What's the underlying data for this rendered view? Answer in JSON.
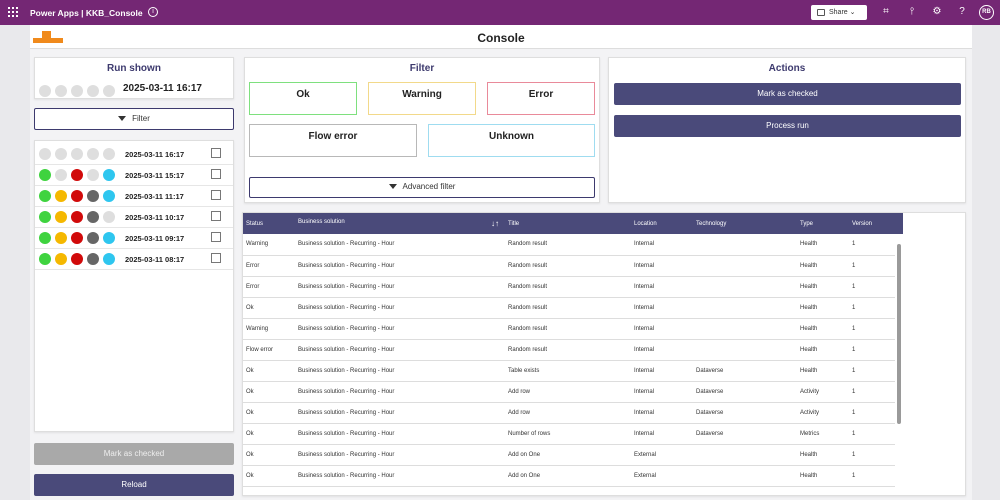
{
  "topbar": {
    "title": "Power Apps  |  KKB_Console",
    "share_label": "Share",
    "avatar_initials": "RB"
  },
  "header": {
    "title": "Console"
  },
  "run_shown": {
    "title": "Run shown",
    "date": "2025-03-11 16:17",
    "dots": [
      "#dedede",
      "#dedede",
      "#dedede",
      "#dedede",
      "#dedede"
    ]
  },
  "filter_button": "Filter",
  "runs": [
    {
      "date": "2025-03-11 16:17",
      "dots": [
        "#dedede",
        "#dedede",
        "#dedede",
        "#dedede",
        "#dedede"
      ]
    },
    {
      "date": "2025-03-11 15:17",
      "dots": [
        "#3fd33f",
        "#dedede",
        "#d10a0a",
        "#dedede",
        "#2ec6ef"
      ]
    },
    {
      "date": "2025-03-11 11:17",
      "dots": [
        "#3fd33f",
        "#f5b800",
        "#d10a0a",
        "#666666",
        "#2ec6ef"
      ]
    },
    {
      "date": "2025-03-11 10:17",
      "dots": [
        "#3fd33f",
        "#f5b800",
        "#d10a0a",
        "#666666",
        "#dedede"
      ]
    },
    {
      "date": "2025-03-11 09:17",
      "dots": [
        "#3fd33f",
        "#f5b800",
        "#d10a0a",
        "#666666",
        "#2ec6ef"
      ]
    },
    {
      "date": "2025-03-11 08:17",
      "dots": [
        "#3fd33f",
        "#f5b800",
        "#d10a0a",
        "#666666",
        "#2ec6ef"
      ]
    }
  ],
  "left_actions": {
    "mark_checked": "Mark as checked",
    "reload": "Reload"
  },
  "filter_panel": {
    "title": "Filter",
    "ok": "Ok",
    "warning": "Warning",
    "error": "Error",
    "flow_error": "Flow error",
    "unknown": "Unknown",
    "advanced": "Advanced filter",
    "colors": {
      "ok": "#7ee07e",
      "warning": "#f2d98a",
      "error": "#e98a9a",
      "flow_error": "#b8b8b8",
      "unknown": "#9fdcf0"
    }
  },
  "actions_panel": {
    "title": "Actions",
    "mark_checked": "Mark as checked",
    "process_run": "Process run"
  },
  "table": {
    "columns": [
      "Status",
      "Business solution",
      "Title",
      "Location",
      "Technology",
      "Type",
      "Version"
    ],
    "rows": [
      [
        "Warning",
        "Business solution - Recurring - Hour",
        "Random result",
        "Internal",
        "",
        "Health",
        "1"
      ],
      [
        "Error",
        "Business solution - Recurring - Hour",
        "Random result",
        "Internal",
        "",
        "Health",
        "1"
      ],
      [
        "Error",
        "Business solution - Recurring - Hour",
        "Random result",
        "Internal",
        "",
        "Health",
        "1"
      ],
      [
        "Ok",
        "Business solution - Recurring - Hour",
        "Random result",
        "Internal",
        "",
        "Health",
        "1"
      ],
      [
        "Warning",
        "Business solution - Recurring - Hour",
        "Random result",
        "Internal",
        "",
        "Health",
        "1"
      ],
      [
        "Flow error",
        "Business solution - Recurring - Hour",
        "Random result",
        "Internal",
        "",
        "Health",
        "1"
      ],
      [
        "Ok",
        "Business solution - Recurring - Hour",
        "Table exists",
        "Internal",
        "Dataverse",
        "Health",
        "1"
      ],
      [
        "Ok",
        "Business solution - Recurring - Hour",
        "Add row",
        "Internal",
        "Dataverse",
        "Activity",
        "1"
      ],
      [
        "Ok",
        "Business solution - Recurring - Hour",
        "Add row",
        "Internal",
        "Dataverse",
        "Activity",
        "1"
      ],
      [
        "Ok",
        "Business solution - Recurring - Hour",
        "Number of rows",
        "Internal",
        "Dataverse",
        "Metrics",
        "1"
      ],
      [
        "Ok",
        "Business solution - Recurring - Hour",
        "Add on One",
        "External",
        "",
        "Health",
        "1"
      ],
      [
        "Ok",
        "Business solution - Recurring - Hour",
        "Add on One",
        "External",
        "",
        "Health",
        "1"
      ]
    ]
  }
}
